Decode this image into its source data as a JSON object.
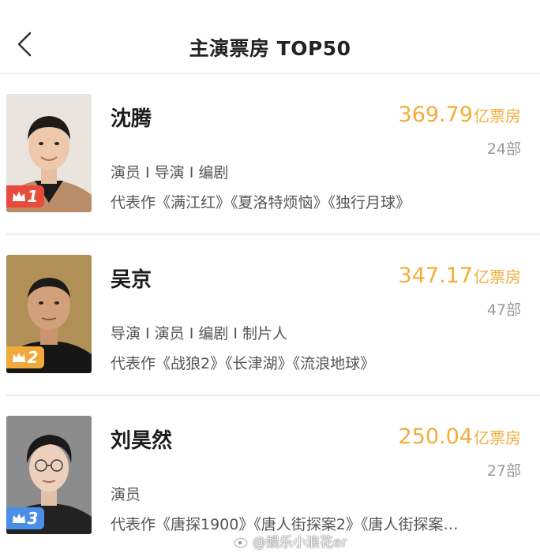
{
  "header": {
    "title": "主演票房 TOP50",
    "back_icon": "chevron-left-icon"
  },
  "actors": [
    {
      "rank": "1",
      "name": "沈腾",
      "box_office_value": "369.79",
      "box_office_unit": "亿票房",
      "film_count": "24部",
      "roles": "演员 I 导演 I 编剧",
      "works": "代表作《满江红》《夏洛特烦恼》《独行月球》",
      "badge_color": "#e84a3c"
    },
    {
      "rank": "2",
      "name": "吴京",
      "box_office_value": "347.17",
      "box_office_unit": "亿票房",
      "film_count": "47部",
      "roles": "导演 I 演员 I 编剧 I 制片人",
      "works": "代表作《战狼2》《长津湖》《流浪地球》",
      "badge_color": "#f0a93a"
    },
    {
      "rank": "3",
      "name": "刘昊然",
      "box_office_value": "250.04",
      "box_office_unit": "亿票房",
      "film_count": "27部",
      "roles": "演员",
      "works": "代表作《唐探1900》《唐人街探案2》《唐人街探案…",
      "badge_color": "#4a8ee8"
    }
  ],
  "colors": {
    "accent_gold": "#f3ad3c",
    "muted_text": "#999999",
    "body_text": "#555555"
  },
  "watermark": {
    "text": "@娱乐小浪花er",
    "icon": "weibo-icon"
  }
}
